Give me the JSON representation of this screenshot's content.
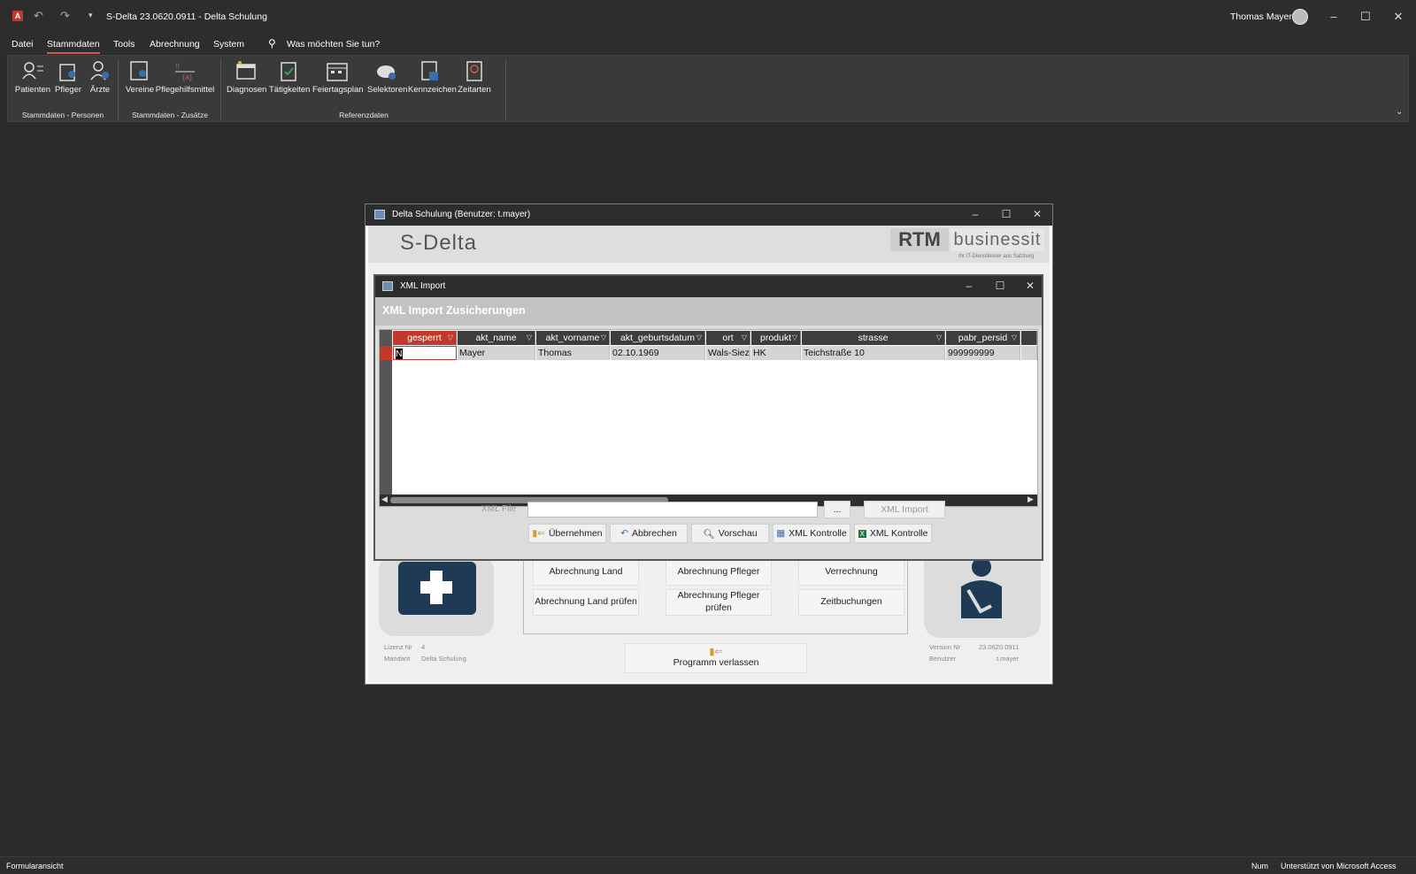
{
  "app": {
    "title": "S-Delta 23.0620.0911 - Delta Schulung",
    "user": "Thomas Mayer"
  },
  "menu": [
    "Datei",
    "Stammdaten",
    "Tools",
    "Abrechnung",
    "System"
  ],
  "search": {
    "placeholder": "Was möchten Sie tun?"
  },
  "ribbon": {
    "buttons": [
      "Patienten",
      "Pfleger",
      "Ärzte",
      "Vereine",
      "Pflegehilfsmittel",
      "Diagnosen",
      "Tätigkeiten",
      "Feiertagsplan",
      "Selektoren",
      "Kennzeichen",
      "Zeitarten"
    ],
    "groups": [
      "Stammdaten - Personen",
      "Stammdaten - Zusätze",
      "Referenzdaten"
    ]
  },
  "delta_window": {
    "title": "Delta Schulung (Benutzer: t.mayer)",
    "brand": "S-Delta",
    "logo_rtm": "RTM",
    "logo_business": "businessit",
    "logo_tagline": "Ihr IT-Dienstleister aus Salzburg",
    "menu_buttons": [
      "Abrechnung Land",
      "Abrechnung Pfleger",
      "Verrechnung",
      "Abrechnung Land prüfen",
      "Abrechnung Pfleger prüfen",
      "Zeitbuchungen"
    ],
    "exit_button": "Programm verlassen",
    "footer": {
      "lizenz_label": "Lizenz Nr",
      "lizenz_value": "4",
      "mandant_label": "Mandant",
      "mandant_value": "Delta Schulung",
      "version_label": "Version Nr",
      "version_value": "23.0620.0911",
      "benutzer_label": "Benutzer",
      "benutzer_value": "t.mayer"
    }
  },
  "xml_dialog": {
    "title": "XML Import",
    "heading": "XML Import Zusicherungen",
    "columns": [
      "gesperrt",
      "akt_name",
      "akt_vorname",
      "akt_geburtsdatum",
      "ort",
      "produkt",
      "strasse",
      "pabr_persid"
    ],
    "row": [
      "N",
      "Mayer",
      "Thomas",
      "02.10.1969",
      "Wals-Siez",
      "HK",
      "Teichstraße 10",
      "999999999"
    ],
    "file_label": "XML File",
    "file_value": "",
    "browse_button": "...",
    "import_button": "XML Import",
    "buttons": [
      "Übernehmen",
      "Abbrechen",
      "Vorschau",
      "XML Kontrolle",
      "XML Kontrolle"
    ]
  },
  "status": {
    "left": "Formularansicht",
    "num": "Num",
    "right": "Unterstützt von Microsoft Access"
  },
  "colors": {
    "accent": "#d25a4f",
    "dark": "#2b2b2b",
    "tile_icon": "#1f3a55"
  }
}
